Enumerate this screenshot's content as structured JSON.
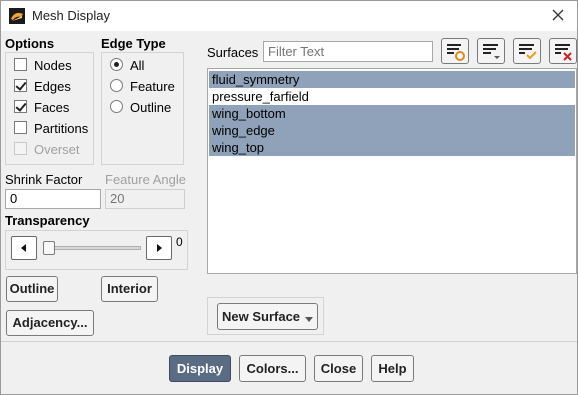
{
  "window": {
    "title": "Mesh Display"
  },
  "options": {
    "heading": "Options",
    "items": [
      {
        "label": "Nodes",
        "checked": false,
        "disabled": false
      },
      {
        "label": "Edges",
        "checked": true,
        "disabled": false
      },
      {
        "label": "Faces",
        "checked": true,
        "disabled": false
      },
      {
        "label": "Partitions",
        "checked": false,
        "disabled": false
      },
      {
        "label": "Overset",
        "checked": false,
        "disabled": true
      }
    ]
  },
  "edge_type": {
    "heading": "Edge Type",
    "items": [
      {
        "label": "All",
        "selected": true
      },
      {
        "label": "Feature",
        "selected": false
      },
      {
        "label": "Outline",
        "selected": false
      }
    ]
  },
  "shrink_factor": {
    "label": "Shrink Factor",
    "value": "0"
  },
  "feature_angle": {
    "label": "Feature Angle",
    "value": "20"
  },
  "transparency": {
    "label": "Transparency",
    "value": "0",
    "level": 0
  },
  "buttons_left": {
    "outline": "Outline",
    "interior": "Interior",
    "adjacency": "Adjacency..."
  },
  "surfaces": {
    "label": "Surfaces",
    "filter_placeholder": "Filter Text",
    "items": [
      {
        "name": "fluid_symmetry",
        "selected": true
      },
      {
        "name": "pressure_farfield",
        "selected": false
      },
      {
        "name": "wing_bottom",
        "selected": true
      },
      {
        "name": "wing_edge",
        "selected": true
      },
      {
        "name": "wing_top",
        "selected": true
      }
    ]
  },
  "new_surface": {
    "label": "New Surface"
  },
  "footer": {
    "display": "Display",
    "colors": "Colors...",
    "close": "Close",
    "help": "Help"
  },
  "colors": {
    "selection": "#8fa2b9",
    "primary_button": "#5a6b84"
  }
}
